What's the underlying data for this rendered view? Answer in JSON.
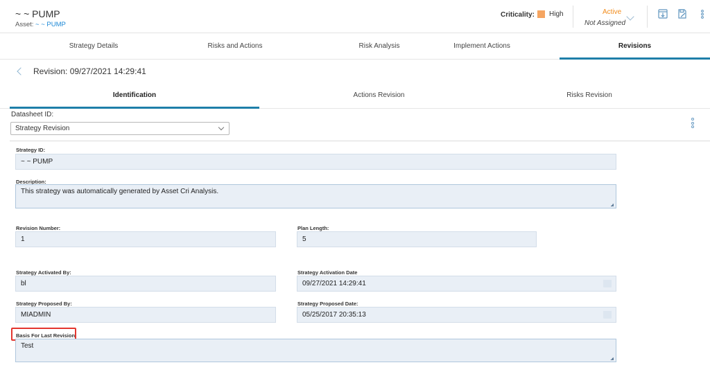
{
  "header": {
    "title": "~ ~ PUMP",
    "asset_label": "Asset:",
    "asset_link": "~ ~ PUMP",
    "criticality_label": "Criticality:",
    "criticality_value": "High",
    "criticality_color": "#f5a561",
    "status": "Active",
    "status_color": "#f28c1c",
    "assignment": "Not Assigned",
    "icons": [
      "chevron-down-icon",
      "download-icon",
      "save-icon",
      "kebab-menu-icon"
    ]
  },
  "tabs": [
    {
      "label": "Strategy Details"
    },
    {
      "label": "Risks and Actions"
    },
    {
      "label": "Risk Analysis"
    },
    {
      "label": "Implement Actions"
    },
    {
      "label": "Revisions"
    }
  ],
  "active_tab": "Revisions",
  "revision": {
    "title": "Revision: 09/27/2021 14:29:41"
  },
  "subtabs": [
    {
      "label": "Identification"
    },
    {
      "label": "Actions Revision"
    },
    {
      "label": "Risks Revision"
    }
  ],
  "active_subtab": "Identification",
  "datasheet": {
    "label": "Datasheet ID:",
    "selected": "Strategy Revision"
  },
  "form": {
    "strategy_id": {
      "label": "Strategy ID:",
      "value": "~ ~ PUMP"
    },
    "description": {
      "label": "Description:",
      "value": "This strategy was automatically generated by Asset Cri Analysis."
    },
    "revision_number": {
      "label": "Revision Number:",
      "value": "1"
    },
    "plan_length": {
      "label": "Plan Length:",
      "value": "5"
    },
    "activated_by": {
      "label": "Strategy Activated By:",
      "value": "bl"
    },
    "activation_date": {
      "label": "Strategy Activation Date",
      "value": "09/27/2021 14:29:41"
    },
    "proposed_by": {
      "label": "Strategy Proposed By:",
      "value": "MIADMIN"
    },
    "proposed_date": {
      "label": "Strategy Proposed Date:",
      "value": "05/25/2017 20:35:13"
    },
    "basis": {
      "label": "Basis For Last Revision:",
      "value": "Test"
    }
  },
  "accent_color": "#1e7fa9",
  "highlight_color": "#e3352e"
}
